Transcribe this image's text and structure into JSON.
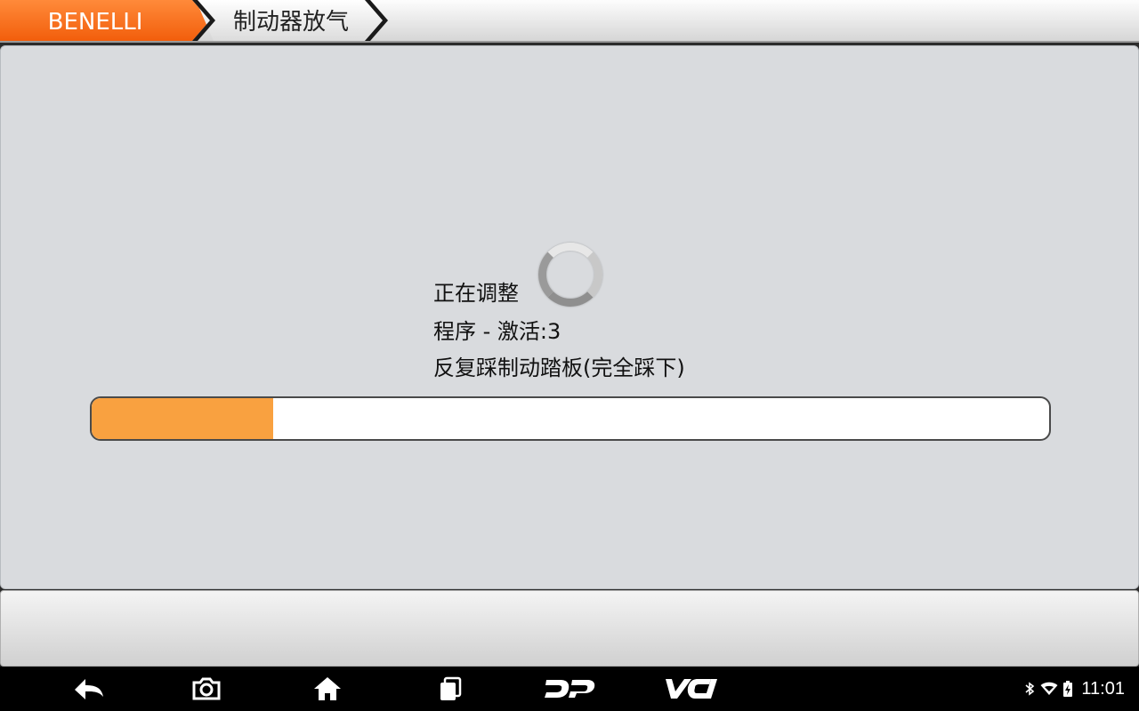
{
  "breadcrumb": {
    "brand": "BENELLI",
    "page": "制动器放气"
  },
  "colors": {
    "brand_tab": "#fb6d17",
    "progress_fill": "#f9a140",
    "panel_bg": "#d9dbde"
  },
  "status": {
    "line1": "正在调整",
    "line2": "程序 - 激活:3",
    "line3": "反复踩制动踏板(完全踩下)",
    "progress_fraction": 0.19
  },
  "navbar": {
    "items": [
      "back-icon",
      "camera-icon",
      "home-icon",
      "recent-apps-icon",
      "dp-icon",
      "vci-icon"
    ],
    "dp_label": "DP",
    "vci_label": "VCI"
  },
  "system_status": {
    "icons": [
      "bluetooth-icon",
      "wifi-icon",
      "battery-charging-icon"
    ],
    "time": "11:01"
  }
}
